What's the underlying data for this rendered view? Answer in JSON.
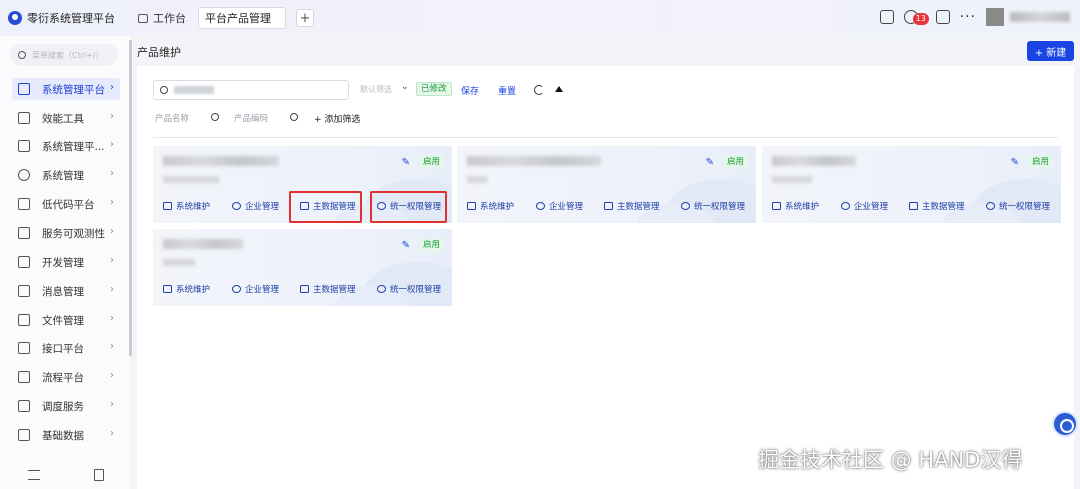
{
  "app": {
    "title": "零衍系统管理平台"
  },
  "tabs": {
    "workspace": "工作台",
    "active": "平台产品管理",
    "add": "+"
  },
  "topbar": {
    "badge": "13",
    "more": "···"
  },
  "sidebar": {
    "search_placeholder": "菜单搜索（Ctrl+/）",
    "items": [
      {
        "label": "系统管理平台"
      },
      {
        "label": "效能工具"
      },
      {
        "label": "系统管理平..."
      },
      {
        "label": "系统管理"
      },
      {
        "label": "低代码平台"
      },
      {
        "label": "服务可观测性"
      },
      {
        "label": "开发管理"
      },
      {
        "label": "消息管理"
      },
      {
        "label": "文件管理"
      },
      {
        "label": "接口平台"
      },
      {
        "label": "流程平台"
      },
      {
        "label": "调度服务"
      },
      {
        "label": "基础数据"
      }
    ]
  },
  "main": {
    "title": "产品维护",
    "new_button": "+ 新建",
    "filter": {
      "default_filter": "默认筛选",
      "modified": "已修改",
      "save": "保存",
      "reset": "重置",
      "product_name_placeholder": "产品名称",
      "product_code_placeholder": "产品编码",
      "add_filter": "+ 添加筛选"
    },
    "cards": [
      {
        "status": "启用",
        "actions": [
          "系统维护",
          "企业管理",
          "主数据管理",
          "统一权限管理"
        ]
      },
      {
        "status": "启用",
        "actions": [
          "系统维护",
          "企业管理",
          "主数据管理",
          "统一权限管理"
        ]
      },
      {
        "status": "启用",
        "actions": [
          "系统维护",
          "企业管理",
          "主数据管理",
          "统一权限管理"
        ]
      },
      {
        "status": "启用",
        "actions": [
          "系统维护",
          "企业管理",
          "主数据管理",
          "统一权限管理"
        ]
      }
    ]
  },
  "watermark": "掘金技术社区 @ HAND汉得",
  "colors": {
    "primary": "#1b44e4",
    "success": "#1a9c3a",
    "highlight": "#e03030"
  }
}
